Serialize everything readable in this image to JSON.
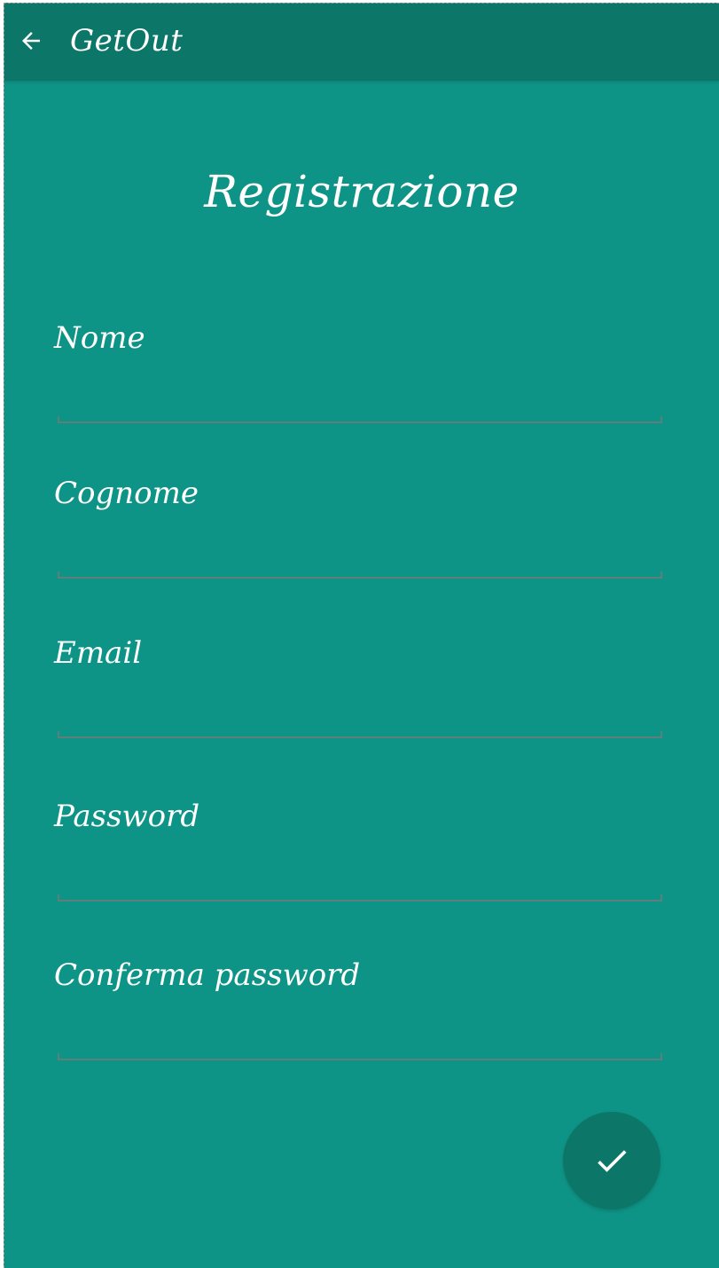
{
  "colors": {
    "background": "#0e9486",
    "appbar": "#0c7668",
    "text": "#ffffff",
    "underline": "#5e7f7b",
    "fab": "#0c7668"
  },
  "appbar": {
    "back_icon": "arrow-left-icon",
    "title": "GetOut"
  },
  "page": {
    "title": "Registrazione"
  },
  "form": {
    "fields": [
      {
        "label": "Nome",
        "value": "",
        "placeholder": ""
      },
      {
        "label": "Cognome",
        "value": "",
        "placeholder": ""
      },
      {
        "label": "Email",
        "value": "",
        "placeholder": ""
      },
      {
        "label": "Password",
        "value": "",
        "placeholder": ""
      },
      {
        "label": "Conferma password",
        "value": "",
        "placeholder": ""
      }
    ]
  },
  "fab": {
    "icon": "check-icon"
  }
}
